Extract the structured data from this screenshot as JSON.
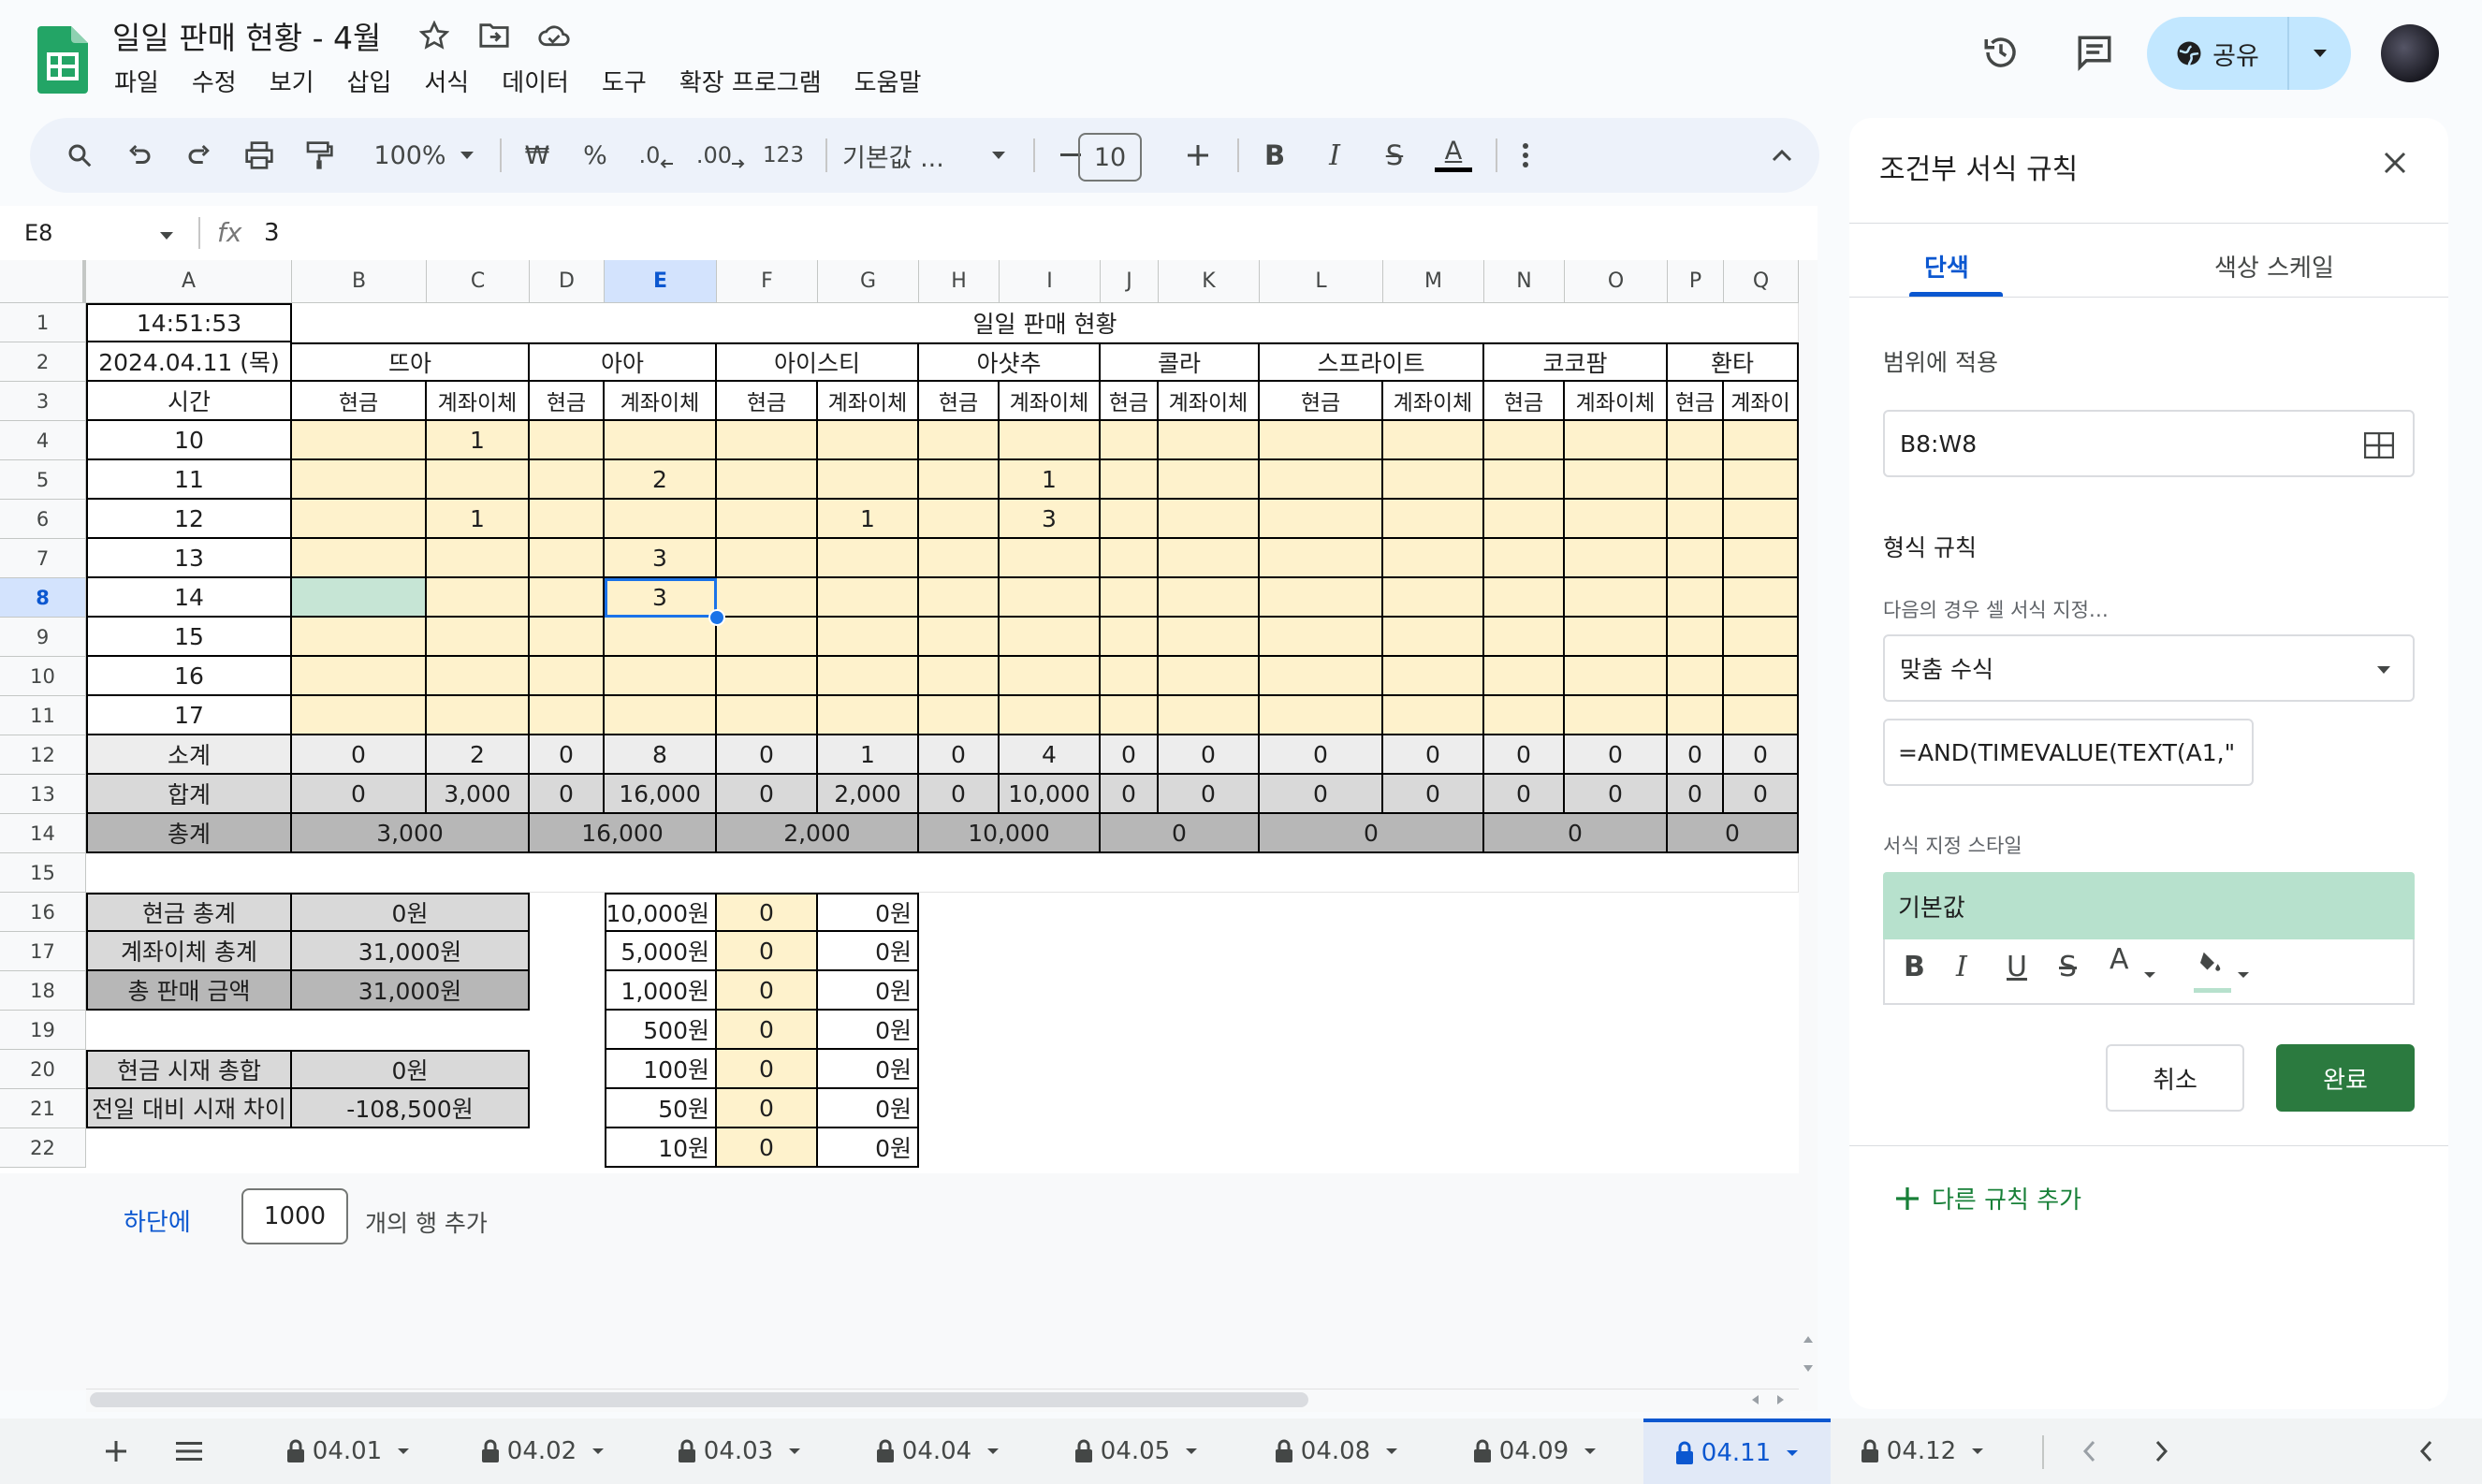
{
  "app": {
    "title": "일일 판매 현황 - 4월"
  },
  "menu": [
    "파일",
    "수정",
    "보기",
    "삽입",
    "서식",
    "데이터",
    "도구",
    "확장 프로그램",
    "도움말"
  ],
  "share": {
    "label": "공유"
  },
  "toolbar": {
    "zoom": "100%",
    "currency": "₩",
    "percent": "%",
    "dec_less": ".0",
    "dec_more": ".00",
    "format_num": "123",
    "font": "기본값 ...",
    "font_size": "10",
    "bold": "B",
    "italic": "I",
    "strike": "S",
    "textcolor": "A"
  },
  "formula": {
    "name_box": "E8",
    "fx": "fx",
    "value": "3"
  },
  "columns": [
    "A",
    "B",
    "C",
    "D",
    "E",
    "F",
    "G",
    "H",
    "I",
    "J",
    "K",
    "L",
    "M",
    "N",
    "O",
    "P",
    "Q"
  ],
  "rows": [
    "1",
    "2",
    "3",
    "4",
    "5",
    "6",
    "7",
    "8",
    "9",
    "10",
    "11",
    "12",
    "13",
    "14",
    "15",
    "16",
    "17",
    "18",
    "19",
    "20",
    "21",
    "22"
  ],
  "sheet": {
    "a1": "14:51:53",
    "a2": "2024.04.11 (목)",
    "title": "일일 판매 현황",
    "a3": "시간",
    "groups": [
      "뜨아",
      "아아",
      "아이스티",
      "아샷추",
      "콜라",
      "스프라이트",
      "코코팜",
      "환타"
    ],
    "sub": [
      "현금",
      "계좌이체",
      "현금",
      "계좌이체",
      "현금",
      "계좌이체",
      "현금",
      "계좌이체",
      "현금",
      "계좌이체",
      "현금",
      "계좌이체",
      "현금",
      "계좌이체",
      "현금",
      "계좌이"
    ],
    "hours": [
      "10",
      "11",
      "12",
      "13",
      "14",
      "15",
      "16",
      "17"
    ],
    "hour_vals": [
      [
        "",
        "1",
        "",
        "",
        "",
        "",
        "",
        "",
        "",
        "",
        "",
        "",
        "",
        "",
        "",
        ""
      ],
      [
        "",
        "",
        "",
        "2",
        "",
        "",
        "",
        "1",
        "",
        "",
        "",
        "",
        "",
        "",
        "",
        ""
      ],
      [
        "",
        "1",
        "",
        "",
        "",
        "1",
        "",
        "3",
        "",
        "",
        "",
        "",
        "",
        "",
        "",
        ""
      ],
      [
        "",
        "",
        "",
        "3",
        "",
        "",
        "",
        "",
        "",
        "",
        "",
        "",
        "",
        "",
        "",
        ""
      ],
      [
        "",
        "",
        "",
        "3",
        "",
        "",
        "",
        "",
        "",
        "",
        "",
        "",
        "",
        "",
        "",
        ""
      ],
      [
        "",
        "",
        "",
        "",
        "",
        "",
        "",
        "",
        "",
        "",
        "",
        "",
        "",
        "",
        "",
        ""
      ],
      [
        "",
        "",
        "",
        "",
        "",
        "",
        "",
        "",
        "",
        "",
        "",
        "",
        "",
        "",
        "",
        ""
      ],
      [
        "",
        "",
        "",
        "",
        "",
        "",
        "",
        "",
        "",
        "",
        "",
        "",
        "",
        "",
        "",
        ""
      ]
    ],
    "subtotal_label": "소계",
    "subtotal": [
      "0",
      "2",
      "0",
      "8",
      "0",
      "1",
      "0",
      "4",
      "0",
      "0",
      "0",
      "0",
      "0",
      "0",
      "0",
      "0"
    ],
    "sum_label": "합계",
    "sum": [
      "0",
      "3,000",
      "0",
      "16,000",
      "0",
      "2,000",
      "0",
      "10,000",
      "0",
      "0",
      "0",
      "0",
      "0",
      "0",
      "0",
      "0"
    ],
    "total_label": "총계",
    "total": [
      "3,000",
      "16,000",
      "2,000",
      "10,000",
      "0",
      "0",
      "0",
      "0"
    ],
    "summary": [
      {
        "label": "현금 총계",
        "value": "0원"
      },
      {
        "label": "계좌이체 총계",
        "value": "31,000원"
      },
      {
        "label": "총 판매 금액",
        "value": "31,000원"
      },
      {
        "label": "현금 시재 총합",
        "value": "0원"
      },
      {
        "label": "전일 대비 시재 차이",
        "value": "-108,500원"
      }
    ],
    "cash": [
      {
        "denom": "10,000원",
        "count": "0",
        "amount": "0원"
      },
      {
        "denom": "5,000원",
        "count": "0",
        "amount": "0원"
      },
      {
        "denom": "1,000원",
        "count": "0",
        "amount": "0원"
      },
      {
        "denom": "500원",
        "count": "0",
        "amount": "0원"
      },
      {
        "denom": "100원",
        "count": "0",
        "amount": "0원"
      },
      {
        "denom": "50원",
        "count": "0",
        "amount": "0원"
      },
      {
        "denom": "10원",
        "count": "0",
        "amount": "0원"
      }
    ]
  },
  "add_rows": {
    "link": "하단에",
    "count": "1000",
    "suffix": "개의 행 추가"
  },
  "tabs": [
    "04.01",
    "04.02",
    "04.03",
    "04.04",
    "04.05",
    "04.08",
    "04.09",
    "04.11",
    "04.12"
  ],
  "active_tab": "04.11",
  "panel": {
    "title": "조건부 서식 규칙",
    "tab_single": "단색",
    "tab_scale": "색상 스케일",
    "range_label": "범위에 적용",
    "range_value": "B8:W8",
    "rules_label": "형식 규칙",
    "condition_label": "다음의 경우 셀 서식 지정…",
    "condition_value": "맞춤 수식",
    "formula_value": "=AND(TIMEVALUE(TEXT(A1,\"",
    "style_label": "서식 지정 스타일",
    "style_preview": "기본값",
    "style_tools": [
      "B",
      "I",
      "U",
      "S",
      "A"
    ],
    "cancel": "취소",
    "done": "완료",
    "add_rule": "다른 규칙 추가"
  },
  "colors": {
    "yellow": "#fef2cc",
    "green_fill": "#c6e5d5",
    "accent": "#0b57d0",
    "done": "#2b7a3f"
  }
}
